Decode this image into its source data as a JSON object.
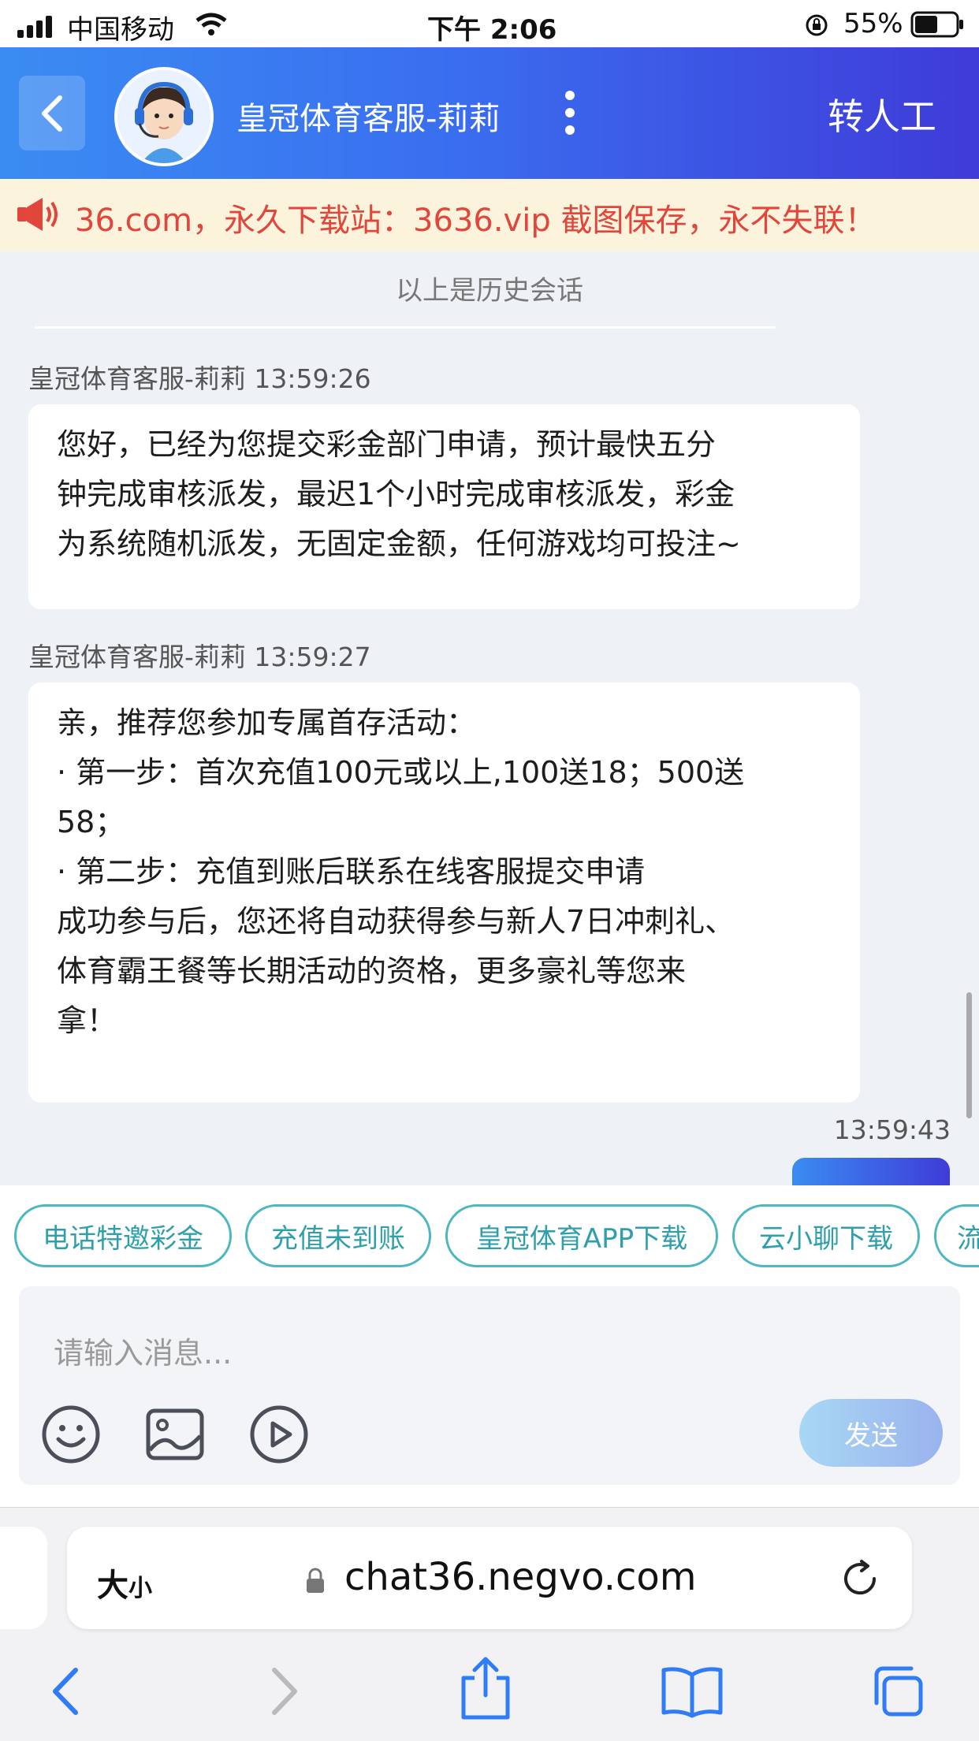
{
  "status_bar": {
    "carrier": "中国移动",
    "time": "下午 2:06",
    "battery": "55%"
  },
  "header": {
    "title": "皇冠体育客服-莉莉",
    "transfer_label": "转人工"
  },
  "notice": {
    "text": "36.com，永久下载站：3636.vip 截图保存，永不失联！"
  },
  "chat": {
    "history_label": "以上是历史会话",
    "messages": [
      {
        "sender": "皇冠体育客服-莉莉 13:59:26",
        "lines": [
          "您好，已经为您提交彩金部门申请，预计最快五分",
          "钟完成审核派发，最迟1个小时完成审核派发，彩金",
          "为系统随机派发，无固定金额，任何游戏均可投注~"
        ]
      },
      {
        "sender": "皇冠体育客服-莉莉 13:59:27",
        "lines": [
          "亲，推荐您参加专属首存活动：",
          "· 第一步：首次充值100元或以上,100送18；500送",
          "58；",
          "· 第二步：充值到账后联系在线客服提交申请",
          "成功参与后，您还将自动获得参与新人7日冲刺礼、",
          "体育霸王餐等长期活动的资格，更多豪礼等您来",
          "拿！"
        ]
      }
    ],
    "user_time": "13:59:43"
  },
  "quick_replies": [
    "电话特邀彩金",
    "充值未到账",
    "皇冠体育APP下载",
    "云小聊下载",
    "流"
  ],
  "input": {
    "placeholder": "请输入消息...",
    "send_label": "发送"
  },
  "safari": {
    "text_size_label": "大",
    "text_size_small": "小",
    "url": "chat36.negvo.com"
  },
  "colors": {
    "header_start": "#3a8cf2",
    "header_end": "#3f3bd8",
    "notice_text": "#e0463b",
    "chip": "#4cb7c1"
  }
}
